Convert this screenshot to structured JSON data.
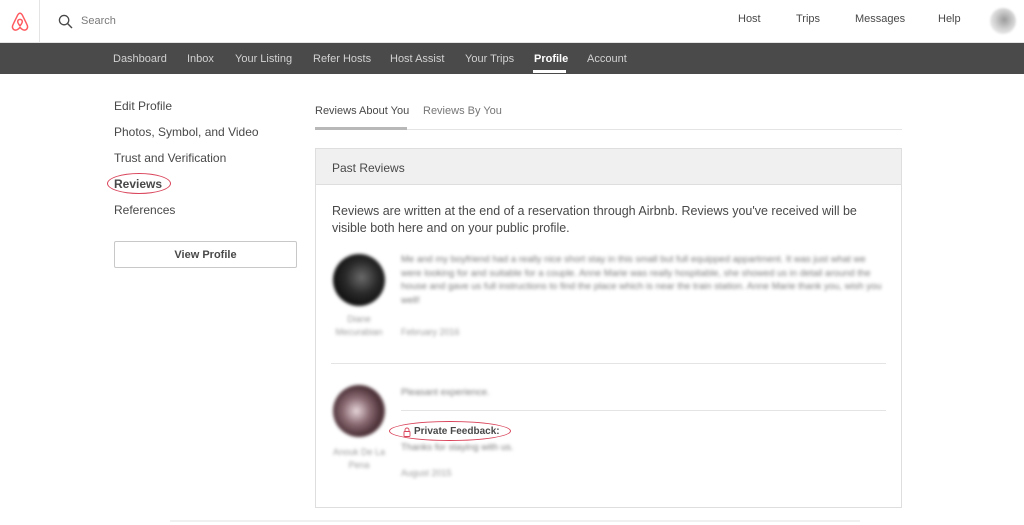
{
  "header": {
    "search_label": "Search",
    "nav": [
      "Host",
      "Trips",
      "Messages",
      "Help"
    ]
  },
  "subnav": {
    "items": [
      "Dashboard",
      "Inbox",
      "Your Listing",
      "Refer Hosts",
      "Host Assist",
      "Your Trips",
      "Profile",
      "Account"
    ],
    "active": "Profile"
  },
  "sidebar": {
    "items": [
      "Edit Profile",
      "Photos, Symbol, and Video",
      "Trust and Verification",
      "Reviews",
      "References"
    ],
    "active": "Reviews",
    "view_profile_label": "View Profile"
  },
  "tabs": {
    "items": [
      "Reviews About You",
      "Reviews By You"
    ],
    "active": "Reviews About You"
  },
  "panel": {
    "title": "Past Reviews",
    "intro": "Reviews are written at the end of a reservation through Airbnb. Reviews you've received will be visible both here and on your public profile."
  },
  "reviews": [
    {
      "reviewer_name": "Diane Mecurabian",
      "text": "Me and my boyfriend had a really nice short stay in this small but full equipped appartment. It was just what we were looking for and suitable for a couple. Anne Marie was really hospitable, she showed us in detail around the house and gave us full instructions to find the place which is near the train station. Anne Marie thank you, wish you well!",
      "date": "February 2016"
    },
    {
      "reviewer_name": "Anouk De La Pena",
      "text": "Pleasant experience.",
      "private_feedback_label": "Private Feedback:",
      "private_feedback": "Thanks for staying with us.",
      "date": "August 2015"
    }
  ],
  "colors": {
    "brand": "#ff5a5f",
    "annotation": "#d9435a",
    "subnav_bg": "#4a4a4a",
    "panel_head_bg": "#f0f0f0"
  },
  "icons": [
    "airbnb-logo-icon",
    "search-icon",
    "lock-icon"
  ]
}
